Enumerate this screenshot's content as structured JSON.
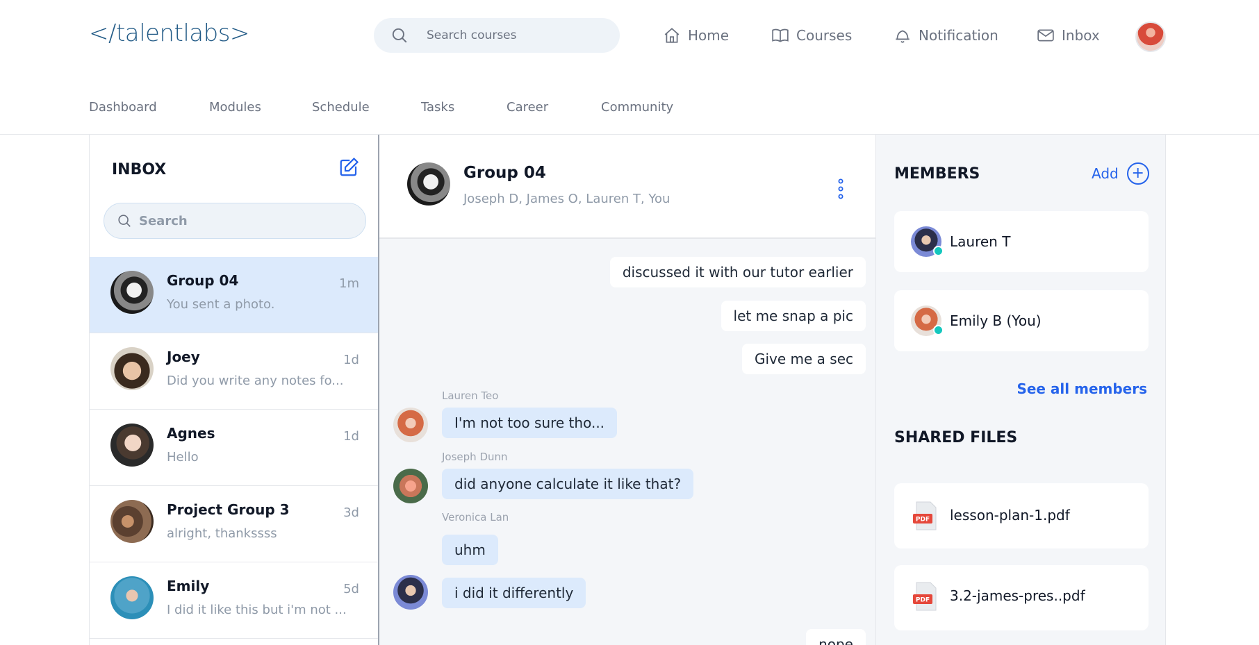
{
  "brand": {
    "logo_text": "</talentlabs>"
  },
  "search": {
    "placeholder": "Search courses"
  },
  "topnav": {
    "home": "Home",
    "courses": "Courses",
    "notification": "Notification",
    "inbox": "Inbox"
  },
  "subnav": [
    "Dashboard",
    "Modules",
    "Schedule",
    "Tasks",
    "Career",
    "Community"
  ],
  "inbox": {
    "title": "INBOX",
    "search_placeholder": "Search",
    "conversations": [
      {
        "name": "Group 04",
        "time": "1m",
        "preview": "You sent a photo.",
        "active": true
      },
      {
        "name": "Joey",
        "time": "1d",
        "preview": "Did you write any notes fo..."
      },
      {
        "name": "Agnes",
        "time": "1d",
        "preview": "Hello"
      },
      {
        "name": "Project Group 3",
        "time": "3d",
        "preview": "alright, thankssss"
      },
      {
        "name": "Emily",
        "time": "5d",
        "preview": "I did it like this but i'm not ..."
      }
    ]
  },
  "chat": {
    "title": "Group 04",
    "members": "Joseph D, James O, Lauren T, You",
    "messages": [
      {
        "dir": "out",
        "text": "discussed it with our tutor earlier"
      },
      {
        "dir": "out",
        "text": "let me snap a pic"
      },
      {
        "dir": "out",
        "text": "Give me a sec"
      },
      {
        "dir": "in",
        "sender": "Lauren Teo",
        "text": "I'm not too sure tho..."
      },
      {
        "dir": "in",
        "sender": "Joseph Dunn",
        "text": "did anyone calculate it like that?"
      },
      {
        "dir": "in",
        "sender": "Veronica Lan",
        "text": "uhm"
      },
      {
        "dir": "in",
        "text": "i did it differently"
      },
      {
        "dir": "out",
        "text": "nope"
      }
    ]
  },
  "members_panel": {
    "title": "MEMBERS",
    "add_label": "Add",
    "members": [
      {
        "name": "Lauren T",
        "online": true
      },
      {
        "name": "Emily B (You)",
        "online": true
      }
    ],
    "see_all": "See all members"
  },
  "files_panel": {
    "title": "SHARED FILES",
    "files": [
      {
        "name": "lesson-plan-1.pdf",
        "type": "PDF"
      },
      {
        "name": "3.2-james-pres..pdf",
        "type": "PDF"
      }
    ]
  },
  "colors": {
    "accent": "#2563eb",
    "active_bg": "#dceafc",
    "online": "#14c7be",
    "pdf_red": "#e5483b"
  }
}
